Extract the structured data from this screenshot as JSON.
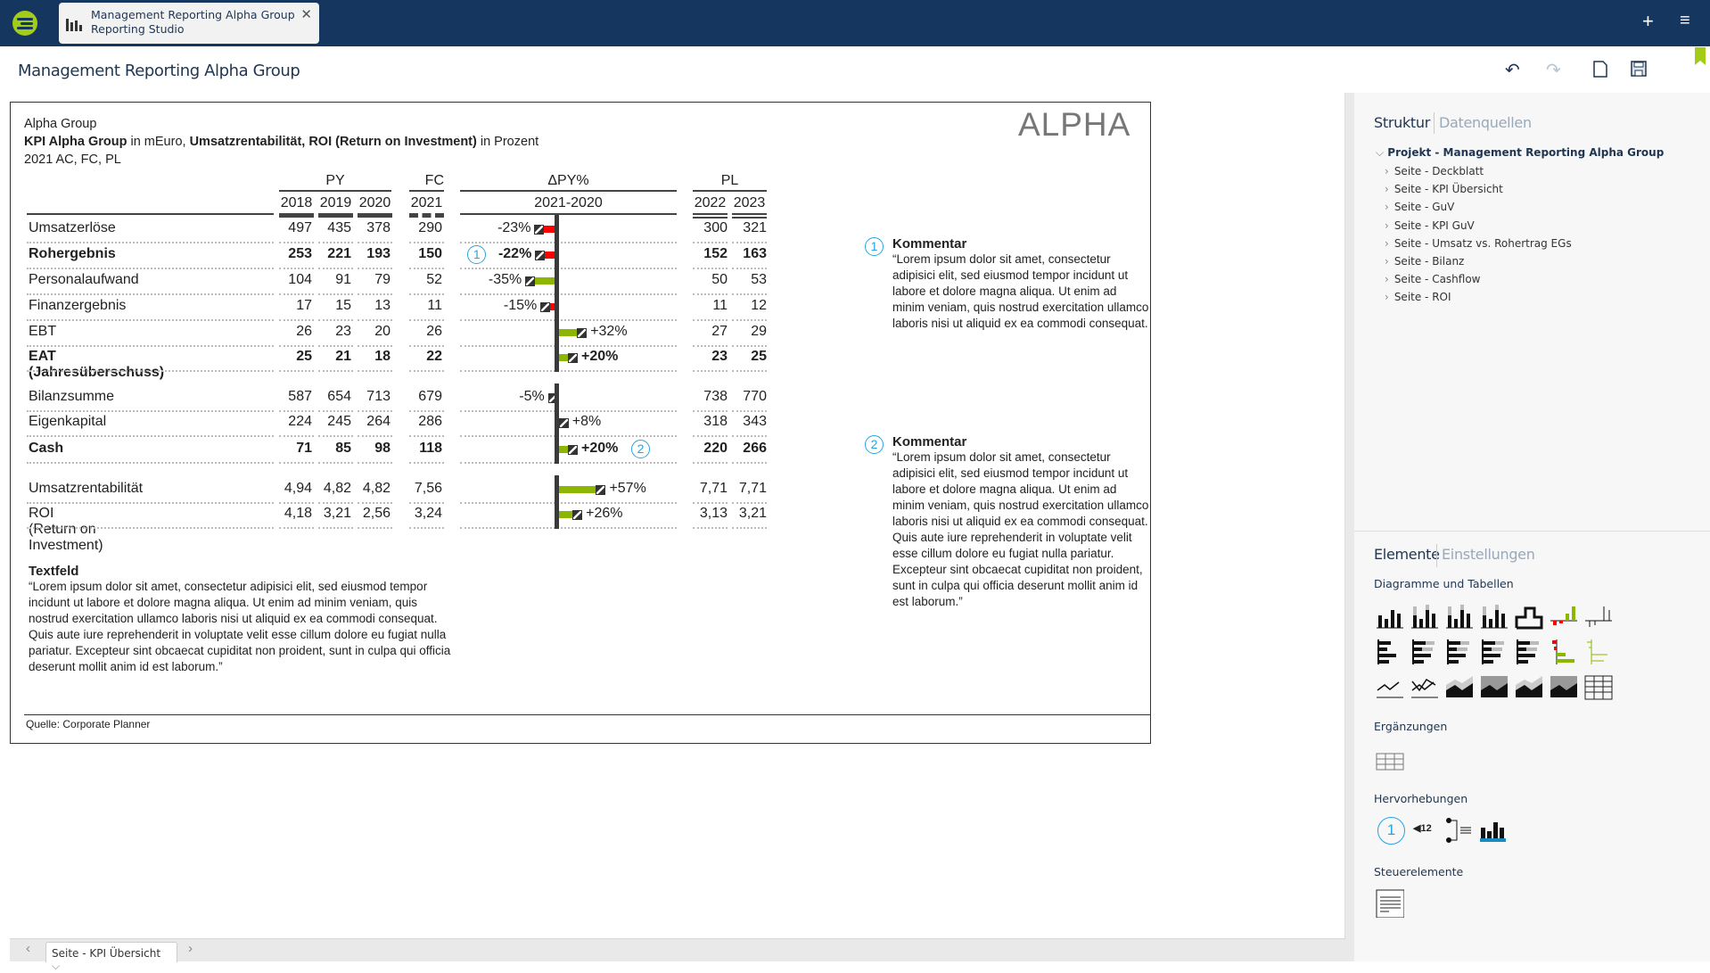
{
  "app": {
    "tab_title_line1": "Management Reporting Alpha Group",
    "tab_title_line2": "Reporting Studio",
    "page_title": "Management Reporting Alpha Group",
    "brand_color": "#14365f",
    "accent_color": "#a3cc19"
  },
  "report": {
    "entity": "Alpha Group",
    "subtitle_bold_1": "KPI Alpha Group",
    "subtitle_text_1": " in mEuro, ",
    "subtitle_bold_2": "Umsatzrentabilität, ROI (Return on Investment)",
    "subtitle_text_2": " in Prozent",
    "scenario": "2021 AC, FC, PL",
    "logo_text": "ALPHA",
    "source": "Quelle: Corporate Planner",
    "table": {
      "group_headers": {
        "py": "PY",
        "fc": "FC",
        "delta": "ΔPY%",
        "pl": "PL"
      },
      "year_headers": [
        "2018",
        "2019",
        "2020",
        "2021",
        "2021-2020",
        "2022",
        "2023"
      ],
      "positive_color": "#8db600",
      "negative_color": "#ff0000",
      "rows": [
        {
          "label": "Umsatzerlöse",
          "bold": false,
          "py": [
            "497",
            "435",
            "378"
          ],
          "fc": "290",
          "delta": -23,
          "delta_label": "-23%",
          "good": false,
          "pl": [
            "300",
            "321"
          ]
        },
        {
          "label": "Rohergebnis",
          "bold": true,
          "py": [
            "253",
            "221",
            "193"
          ],
          "fc": "150",
          "delta": -22,
          "delta_label": "-22%",
          "good": false,
          "pl": [
            "152",
            "163"
          ],
          "marker": "1"
        },
        {
          "label": "Personalaufwand",
          "bold": false,
          "py": [
            "104",
            "91",
            "79"
          ],
          "fc": "52",
          "delta": -35,
          "delta_label": "-35%",
          "good": true,
          "pl": [
            "50",
            "53"
          ]
        },
        {
          "label": "Finanzergebnis",
          "bold": false,
          "py": [
            "17",
            "15",
            "13"
          ],
          "fc": "11",
          "delta": -15,
          "delta_label": "-15%",
          "good": false,
          "pl": [
            "11",
            "12"
          ]
        },
        {
          "label": "EBT",
          "bold": false,
          "py": [
            "26",
            "23",
            "20"
          ],
          "fc": "26",
          "delta": 32,
          "delta_label": "+32%",
          "good": true,
          "pl": [
            "27",
            "29"
          ]
        },
        {
          "label": "EAT (Jahresüberschuss)",
          "bold": true,
          "py": [
            "25",
            "21",
            "18"
          ],
          "fc": "22",
          "delta": 20,
          "delta_label": "+20%",
          "good": true,
          "pl": [
            "23",
            "25"
          ]
        },
        {
          "label": "Bilanzsumme",
          "bold": false,
          "py": [
            "587",
            "654",
            "713"
          ],
          "fc": "679",
          "delta": -5,
          "delta_label": "-5%",
          "good": false,
          "pl": [
            "738",
            "770"
          ]
        },
        {
          "label": "Eigenkapital",
          "bold": false,
          "py": [
            "224",
            "245",
            "264"
          ],
          "fc": "286",
          "delta": 8,
          "delta_label": "+8%",
          "good": true,
          "pl": [
            "318",
            "343"
          ]
        },
        {
          "label": "Cash",
          "bold": true,
          "py": [
            "71",
            "85",
            "98"
          ],
          "fc": "118",
          "delta": 20,
          "delta_label": "+20%",
          "good": true,
          "pl": [
            "220",
            "266"
          ],
          "marker": "2"
        },
        {
          "label": "Umsatzrentabilität",
          "bold": false,
          "py": [
            "4,94",
            "4,82",
            "4,82"
          ],
          "fc": "7,56",
          "delta": 57,
          "delta_label": "+57%",
          "good": true,
          "pl": [
            "7,71",
            "7,71"
          ]
        },
        {
          "label": "ROI (Return on Investment)",
          "bold": false,
          "py": [
            "4,18",
            "3,21",
            "2,56"
          ],
          "fc": "3,24",
          "delta": 26,
          "delta_label": "+26%",
          "good": true,
          "pl": [
            "3,13",
            "3,21"
          ]
        }
      ]
    },
    "comments": [
      {
        "number": "1",
        "title": "Kommentar",
        "text": "“Lorem ipsum dolor sit amet, consectetur adipisici elit, sed eiusmod tempor incidunt ut labore et dolore magna aliqua. Ut enim ad minim veniam, quis nostrud exercitation ullamco laboris nisi ut aliquid ex ea commodi consequat."
      },
      {
        "number": "2",
        "title": "Kommentar",
        "text": "“Lorem ipsum dolor sit amet, consectetur adipisici elit, sed eiusmod tempor incidunt ut labore et dolore magna aliqua. Ut enim ad minim veniam, quis nostrud exercitation ullamco laboris nisi ut aliquid ex ea commodi consequat. Quis aute iure reprehenderit in voluptate velit esse cillum dolore eu fugiat nulla pariatur. Excepteur sint obcaecat cupiditat non proident, sunt in culpa qui officia deserunt mollit anim id est laborum.”"
      }
    ],
    "textfield": {
      "title": "Textfeld",
      "text": "“Lorem ipsum dolor sit amet, consectetur adipisici elit, sed eiusmod tempor incidunt ut labore et dolore magna aliqua. Ut enim ad minim veniam, quis nostrud exercitation ullamco laboris nisi ut aliquid ex ea commodi consequat. Quis aute iure reprehenderit in voluptate velit esse cillum dolore eu fugiat nulla pariatur. Excepteur sint obcaecat cupiditat non proident, sunt in culpa qui officia deserunt mollit anim id est laborum.”"
    }
  },
  "bottom": {
    "page_select": "Seite - KPI Übersicht"
  },
  "right_panel": {
    "tabs": [
      "Struktur",
      "Datenquellen"
    ],
    "project": "Projekt - Management Reporting Alpha Group",
    "pages": [
      "Seite - Deckblatt",
      "Seite - KPI Übersicht",
      "Seite - GuV",
      "Seite - KPI GuV",
      "Seite - Umsatz vs. Rohertrag EGs",
      "Seite - Bilanz",
      "Seite - Cashflow",
      "Seite - ROI"
    ],
    "element_tabs": [
      "Elemente",
      "Einstellungen"
    ],
    "sections": {
      "charts": "Diagramme und Tabellen",
      "additions": "Ergänzungen",
      "highlights": "Hervorhebungen",
      "controls": "Steuerelemente"
    },
    "highlight_number": "1",
    "highlight_value": "12"
  }
}
